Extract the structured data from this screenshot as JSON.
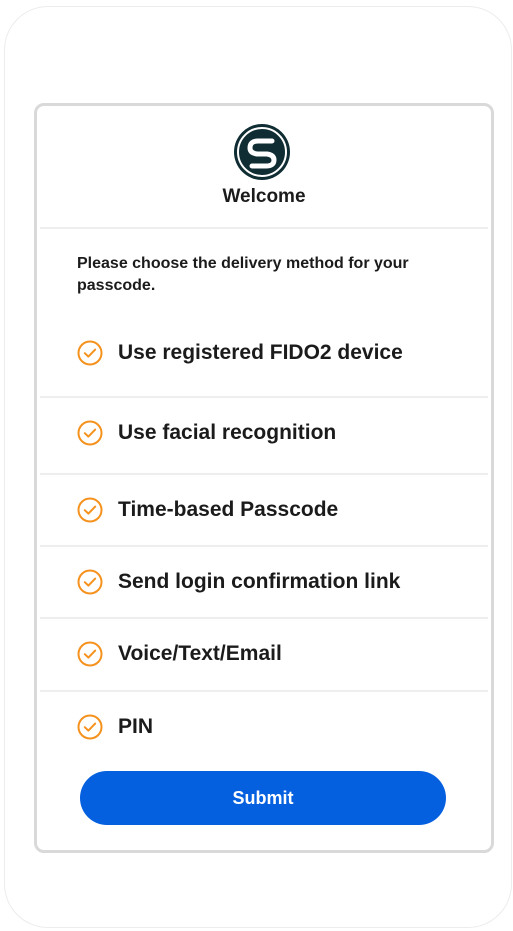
{
  "header": {
    "logo_icon": "s-circle-logo-icon",
    "title": "Welcome"
  },
  "prompt": "Please choose the delivery method for your passcode.",
  "options": [
    {
      "label": "Use registered FIDO2 device",
      "icon": "check-circle-icon"
    },
    {
      "label": "Use facial recognition",
      "icon": "check-circle-icon"
    },
    {
      "label": "Time-based Passcode",
      "icon": "check-circle-icon"
    },
    {
      "label": "Send login confirmation link",
      "icon": "check-circle-icon"
    },
    {
      "label": "Voice/Text/Email",
      "icon": "check-circle-icon"
    },
    {
      "label": "PIN",
      "icon": "check-circle-icon"
    }
  ],
  "submit_label": "Submit",
  "colors": {
    "accent": "#0560e0",
    "check": "#f5921e",
    "logo": "#0f2d33",
    "text": "#1b1b1b"
  }
}
